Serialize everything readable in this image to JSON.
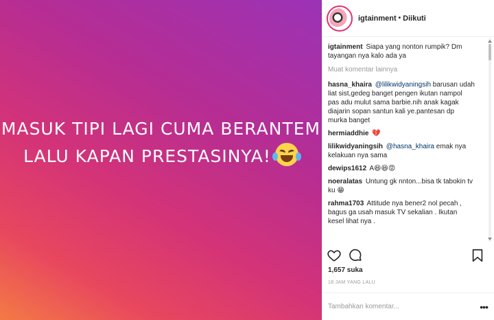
{
  "post": {
    "image_lines": [
      "MASUK TIPI LAGI CUMA BERANTEM",
      "LALU KAPAN PRESTASINYA!"
    ],
    "image_emoji": "face-with-tears-of-joy"
  },
  "header": {
    "username": "igtainment",
    "separator": "•",
    "follow_status": "Diikuti"
  },
  "caption": {
    "username": "igtainment",
    "text": "Siapa yang nonton rumpik? Dm tayangan nya kalo ada ya"
  },
  "load_more_label": "Muat komentar lainnya",
  "comments": [
    {
      "username": "hasna_khaira",
      "mention": "@lilikwidyaningsih",
      "text": "barusan udah liat sist,gedeg banget pengen ikutan nampol pas adu mulut sama barbie.nih anak kagak diajarin sopan santun kali ye.pantesan dp murka banget"
    },
    {
      "username": "hermiaddhie",
      "mention": "",
      "text": "💔"
    },
    {
      "username": "lilikwidyaningsih",
      "mention": "@hasna_khaira",
      "text": "emak nya kelakuan nya sama"
    },
    {
      "username": "dewips1612",
      "mention": "",
      "text": "A😆😆😡"
    },
    {
      "username": "noeralatas",
      "mention": "",
      "text": "Untung gk nnton...bisa tk tabokin tv ku 😁"
    },
    {
      "username": "rahma1703",
      "mention": "",
      "text": "Attitude nya bener2 nol pecah , bagus ga usah masuk TV sekalian . Ikutan kesel lihat nya ."
    }
  ],
  "likes": "1,657 suka",
  "timestamp": "18 JAM YANG LALU",
  "comment_input": {
    "placeholder": "Tambahkan komentar..."
  },
  "more_icon": "ellipsis-icon"
}
